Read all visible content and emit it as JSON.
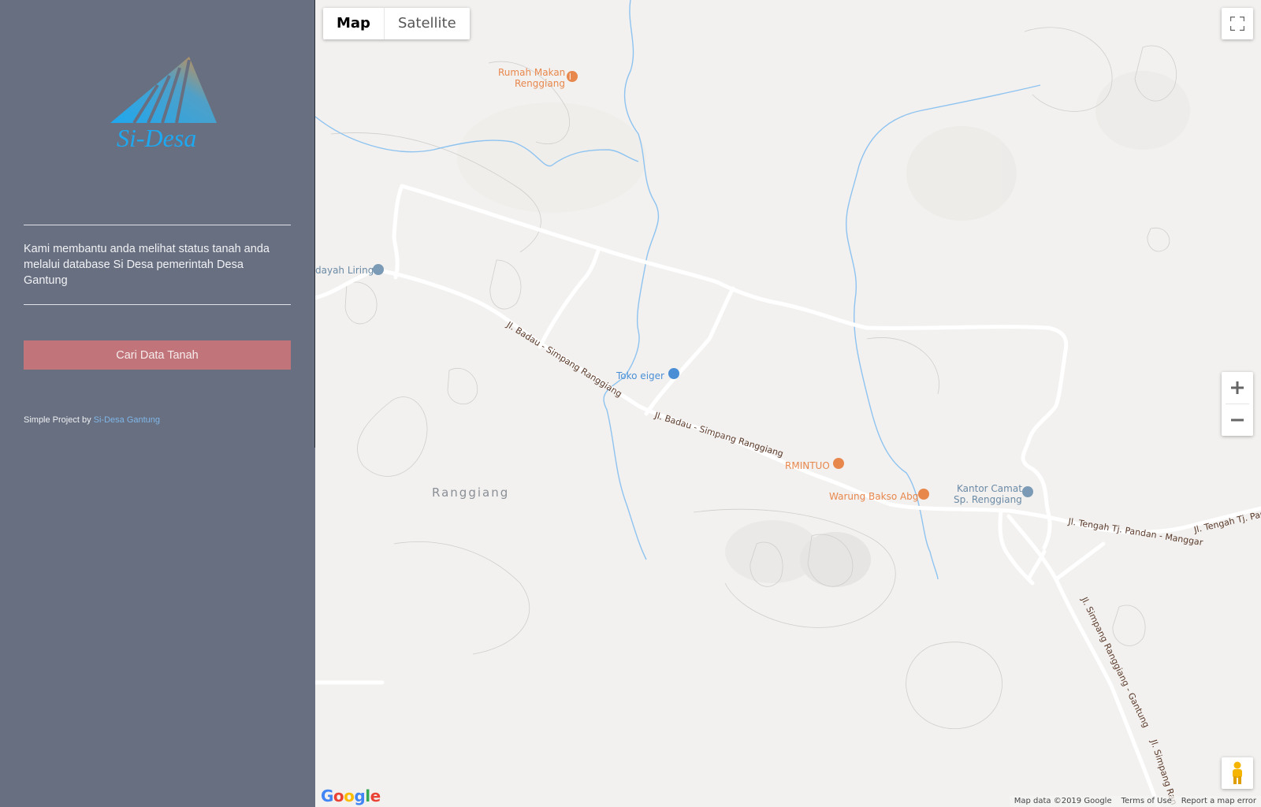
{
  "sidebar": {
    "logo_text": "Si-Desa",
    "tagline": "Kami membantu anda melihat status tanah anda melalui database Si Desa pemerintah Desa Gantung",
    "button_label": "Cari Data Tanah",
    "credit_prefix": "Simple Project by",
    "credit_link": "Si-Desa Gantung",
    "colors": {
      "background": "#686f80",
      "button": "#c1747a",
      "link": "#7fb6e8"
    }
  },
  "map": {
    "map_type": {
      "map_label": "Map",
      "satellite_label": "Satellite",
      "selected": "Map"
    },
    "controls": {
      "fullscreen_icon": "fullscreen-icon",
      "zoom_in_icon": "plus-icon",
      "zoom_out_icon": "minus-icon",
      "pegman_icon": "pegman-icon"
    },
    "pois": {
      "rumah_makan": "Rumah Makan Renggiang",
      "rumah_makan_l1": "Rumah Makan",
      "rumah_makan_l2": "Renggiang",
      "dayah_liring": "dayah Liring",
      "toko_eiger": "Toko eiger",
      "rmintuo": "RMINTUO",
      "warung_bakso": "Warung Bakso Abg",
      "kantor_camat_l1": "Kantor Camat",
      "kantor_camat_l2": "Sp. Renggiang"
    },
    "area_label": "Ranggiang",
    "roads": {
      "badau_1": "Jl. Badau - Simpang Ranggiang",
      "badau_2": "Jl. Badau - Simpang Ranggiang",
      "tengah_1": "Jl. Tengah Tj. Pandan - Manggar",
      "tengah_2": "Jl. Tengah Tj. Pan",
      "simpang_1": "Jl. Simpang Ranggiang - Gantung",
      "simpang_2": "Jl. Simpang Ran"
    },
    "attribution": {
      "map_data": "Map data ©2019 Google",
      "terms": "Terms of Use",
      "report": "Report a map error"
    },
    "google_logo": "Google",
    "colors": {
      "water": "#8ec3f0",
      "road": "#ffffff",
      "food_poi": "#e8874c",
      "shop_poi": "#4a8fd6",
      "gov_poi": "#7a9ab5"
    }
  }
}
